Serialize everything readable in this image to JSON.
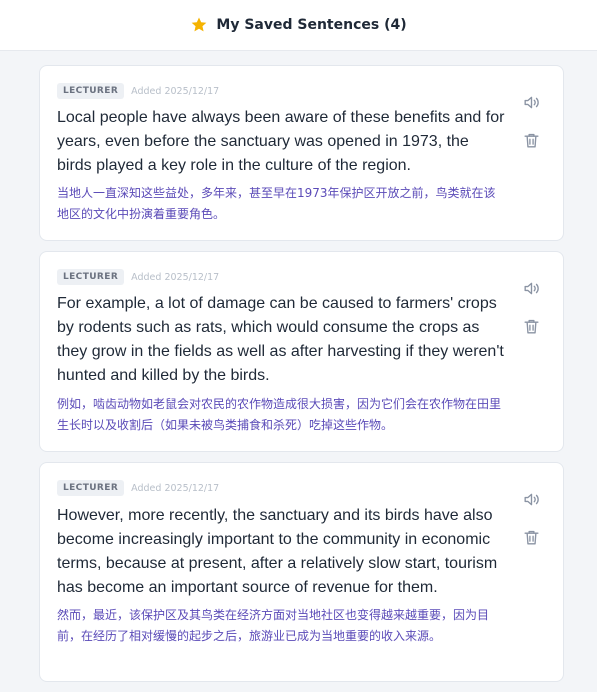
{
  "header": {
    "title": "My Saved Sentences (4)",
    "star_icon": "star-icon",
    "star_color": "#f5b301"
  },
  "sentences": [
    {
      "badge": "LECTURER",
      "added": "Added 2025/12/17",
      "english": "Local people have always been aware of these benefits and for years, even before the sanctuary was opened in 1973, the birds played a key role in the culture of the region.",
      "chinese": "当地人一直深知这些益处，多年来，甚至早在1973年保护区开放之前，鸟类就在该地区的文化中扮演着重要角色。"
    },
    {
      "badge": "LECTURER",
      "added": "Added 2025/12/17",
      "english": "For example, a lot of damage can be caused to farmers' crops by rodents such as rats, which would consume the crops as they grow in the fields as well as after harvesting if they weren't hunted and killed by the birds.",
      "chinese": "例如，啮齿动物如老鼠会对农民的农作物造成很大损害，因为它们会在农作物在田里生长时以及收割后（如果未被鸟类捕食和杀死）吃掉这些作物。"
    },
    {
      "badge": "LECTURER",
      "added": "Added 2025/12/17",
      "english": "However, more recently, the sanctuary and its birds have also become increasingly important to the community in economic terms, because at present, after a relatively slow start, tourism has become an important source of revenue for them.",
      "chinese": "然而，最近，该保护区及其鸟类在经济方面对当地社区也变得越来越重要，因为目前，在经历了相对缓慢的起步之后，旅游业已成为当地重要的收入来源。"
    }
  ],
  "icons": {
    "speak": "speaker-icon",
    "delete": "trash-icon"
  },
  "colors": {
    "accent_chinese": "#5b4bb8",
    "icon_gray": "#8a93a3"
  }
}
